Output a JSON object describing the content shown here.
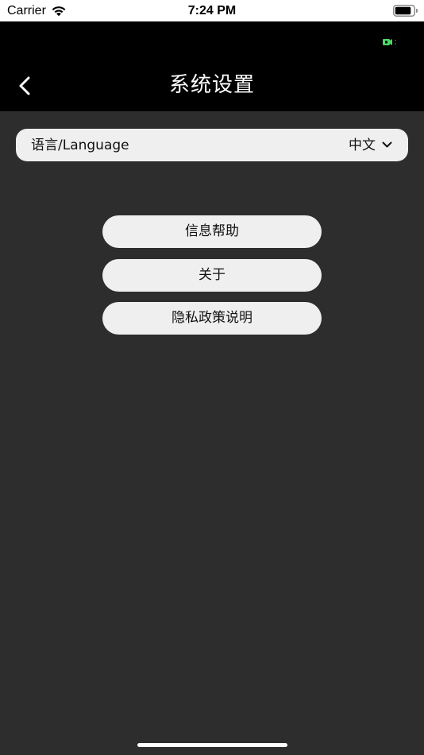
{
  "status_bar": {
    "carrier": "Carrier",
    "time": "7:24 PM",
    "wifi_icon": "wifi-icon",
    "battery_icon": "battery-icon"
  },
  "header": {
    "title": "系统设置",
    "back_icon": "chevron-left-icon",
    "charge_indicator_icon": "battery-charging-icon",
    "charge_color": "#4cd964"
  },
  "language": {
    "label": "语言/Language",
    "value": "中文",
    "dropdown_icon": "chevron-down-icon"
  },
  "buttons": {
    "help": "信息帮助",
    "about": "关于",
    "privacy": "隐私政策说明"
  },
  "colors": {
    "background": "#2d2d2d",
    "header": "#000000",
    "pill": "#efefef"
  }
}
